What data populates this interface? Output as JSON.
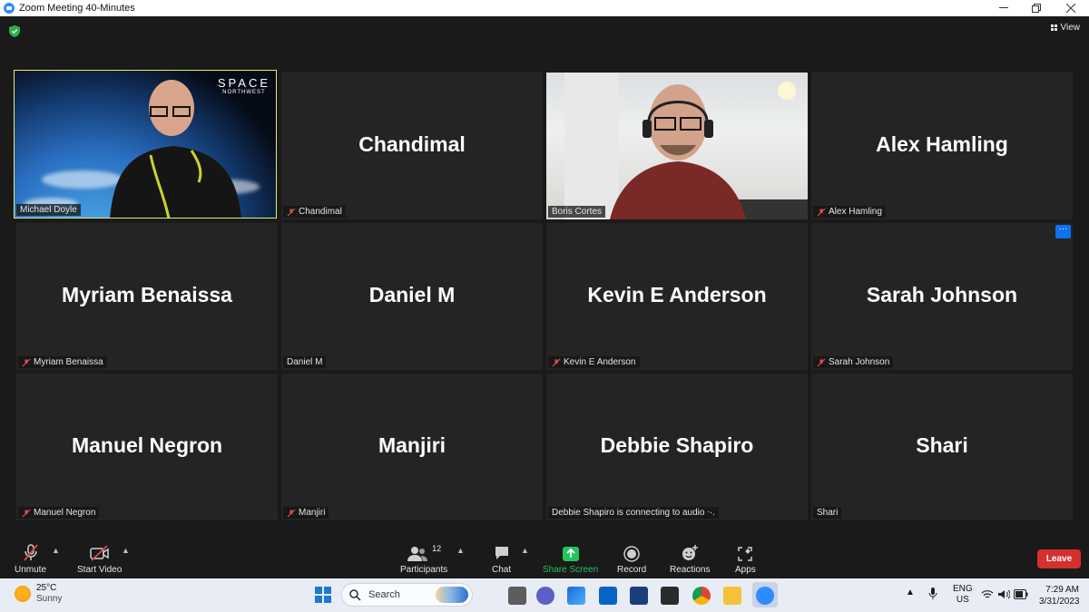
{
  "window": {
    "title": "Zoom Meeting 40-Minutes"
  },
  "top": {
    "view_label": "View"
  },
  "tiles": [
    {
      "name": "Michael Doyle",
      "label": "Michael Doyle",
      "muted": false,
      "video": "space"
    },
    {
      "name": "Chandimal",
      "label": "Chandimal",
      "muted": true
    },
    {
      "name": "Boris Cortes",
      "label": "Boris Cortes",
      "muted": false,
      "video": "room"
    },
    {
      "name": "Alex Hamling",
      "label": "Alex Hamling",
      "muted": true
    },
    {
      "name": "Myriam Benaissa",
      "label": "Myriam Benaissa",
      "muted": true
    },
    {
      "name": "Daniel M",
      "label": "Daniel M",
      "muted": false
    },
    {
      "name": "Kevin E Anderson",
      "label": "Kevin E Anderson",
      "muted": true
    },
    {
      "name": "Sarah Johnson",
      "label": "Sarah Johnson",
      "muted": true
    },
    {
      "name": "Manuel Negron",
      "label": "Manuel Negron",
      "muted": true
    },
    {
      "name": "Manjiri",
      "label": "Manjiri",
      "muted": true
    },
    {
      "name": "Debbie Shapiro",
      "label": "Debbie Shapiro is connecting to audio ᐧ·.",
      "muted": false
    },
    {
      "name": "Shari",
      "label": "Shari",
      "muted": false
    }
  ],
  "video_logo": {
    "line1": "SPACE",
    "line2": "NORTHWEST"
  },
  "more_label": "···",
  "controls": {
    "unmute": "Unmute",
    "start_video": "Start Video",
    "participants": "Participants",
    "participant_count": "12",
    "chat": "Chat",
    "share_screen": "Share Screen",
    "record": "Record",
    "reactions": "Reactions",
    "apps": "Apps",
    "leave": "Leave"
  },
  "taskbar": {
    "weather_temp": "25°C",
    "weather_desc": "Sunny",
    "search_label": "Search",
    "lang1": "ENG",
    "lang2": "US",
    "time": "7:29 AM",
    "date": "3/31/2023"
  },
  "colors": {
    "accent": "#2d8cff",
    "active_border": "#e5ee7c",
    "leave": "#d5302f",
    "share": "#23c45e",
    "mute_red": "#e04b4b"
  }
}
